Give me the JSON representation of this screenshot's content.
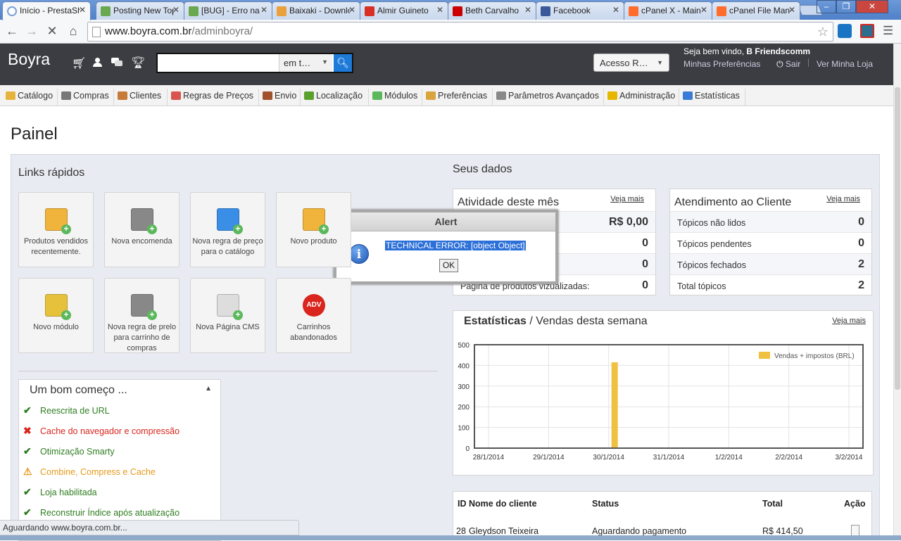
{
  "browser": {
    "tabs": [
      {
        "title": "Início - PrestaShop",
        "fav_color": "#ffffff",
        "active": true
      },
      {
        "title": "Posting New Topic",
        "fav_color": "#6aa84f",
        "active": false
      },
      {
        "title": "[BUG] - Erro na ...",
        "fav_color": "#6aa84f",
        "active": false
      },
      {
        "title": "Baixaki - Downloads",
        "fav_color": "#e9a23b",
        "active": false
      },
      {
        "title": "Almir Guineto",
        "fav_color": "#d93025",
        "active": false
      },
      {
        "title": "Beth Carvalho",
        "fav_color": "#cc0000",
        "active": false
      },
      {
        "title": "Facebook",
        "fav_color": "#3b5998",
        "active": false
      },
      {
        "title": "cPanel X - Main",
        "fav_color": "#ff6c2c",
        "active": false
      },
      {
        "title": "cPanel File Manager",
        "fav_color": "#ff6c2c",
        "active": false
      }
    ],
    "url_host": "www.boyra.com.br",
    "url_path": "/adminboyra/",
    "status_text": "Aguardando www.boyra.com.br..."
  },
  "header": {
    "brand": "Boyra",
    "search_scope": "em t…",
    "quick_access": "Acesso R…",
    "welcome_prefix": "Seja bem vindo,",
    "welcome_user": "B Friendscomm",
    "preferences_link": "Minhas Preferências",
    "logout_link": "Sair",
    "view_store_link": "Ver Minha Loja"
  },
  "menu": [
    {
      "label": "Catálogo",
      "color": "#e6b33c"
    },
    {
      "label": "Compras",
      "color": "#777777"
    },
    {
      "label": "Clientes",
      "color": "#c77b3a"
    },
    {
      "label": "Regras de Preços",
      "color": "#d9534f"
    },
    {
      "label": "Envio",
      "color": "#a0522d"
    },
    {
      "label": "Localização",
      "color": "#5aa02c"
    },
    {
      "label": "Módulos",
      "color": "#5cb85c"
    },
    {
      "label": "Preferências",
      "color": "#d9a43b"
    },
    {
      "label": "Parâmetros Avançados",
      "color": "#888888"
    },
    {
      "label": "Administração",
      "color": "#e5b700"
    },
    {
      "label": "Estatísticas",
      "color": "#3a7bd5"
    }
  ],
  "page": {
    "title": "Painel",
    "quick_links_title": "Links rápidos",
    "quick_links": [
      {
        "label": "Produtos vendidos recentemente.",
        "icon": "folder-arrow-icon",
        "color": "#f0b43c"
      },
      {
        "label": "Nova encomenda",
        "icon": "cart-add-icon",
        "color": "#888888"
      },
      {
        "label": "Nova regra de preço para o catálogo",
        "icon": "book-icon",
        "color": "#3a8ee6"
      },
      {
        "label": "Novo produto",
        "icon": "folder-add-icon",
        "color": "#f0b43c"
      },
      {
        "label": "Novo módulo",
        "icon": "puzzle-add-icon",
        "color": "#e6c23c"
      },
      {
        "label": "Nova regra de prelo para carrinho de compras",
        "icon": "cart-up-icon",
        "color": "#888888"
      },
      {
        "label": "Nova Página CMS",
        "icon": "page-add-icon",
        "color": "#dddddd"
      },
      {
        "label": "Carrinhos abandonados",
        "icon": "adv-badge-icon",
        "color": "#d9251d",
        "badge": "ADV"
      }
    ],
    "start_title": "Um bom começo ...",
    "start_items": [
      {
        "label": "Reescrita de URL",
        "status": "ok",
        "mark": "✔",
        "color": "#2e7d1f"
      },
      {
        "label": "Cache do navegador e compressão",
        "status": "error",
        "mark": "✖",
        "color": "#d9251d"
      },
      {
        "label": "Otimização Smarty",
        "status": "ok",
        "mark": "✔",
        "color": "#2e7d1f"
      },
      {
        "label": "Combine, Compress e Cache",
        "status": "warning",
        "mark": "⚠",
        "color": "#e69a1a"
      },
      {
        "label": "Loja habilitada",
        "status": "ok",
        "mark": "✔",
        "color": "#2e7d1f"
      },
      {
        "label": "Reconstruir Índice após atualização",
        "status": "ok",
        "mark": "✔",
        "color": "#2e7d1f"
      }
    ]
  },
  "your_data": {
    "title": "Seus dados",
    "activity": {
      "title": "Atividade deste mês",
      "more": "Veja mais",
      "rows": [
        {
          "label": "",
          "value": "R$ 0,00"
        },
        {
          "label": "",
          "value": "0"
        },
        {
          "label": "",
          "value": "0"
        },
        {
          "label": "Página de produtos vizualizadas:",
          "value": "0"
        }
      ]
    },
    "support": {
      "title": "Atendimento ao Cliente",
      "more": "Veja mais",
      "rows": [
        {
          "label": "Tópicos não lidos",
          "value": "0"
        },
        {
          "label": "Tópicos pendentes",
          "value": "0"
        },
        {
          "label": "Tópicos fechados",
          "value": "2"
        },
        {
          "label": "Total tópicos",
          "value": "2"
        }
      ]
    }
  },
  "stats": {
    "title_bold": "Estatísticas",
    "title_rest": "/ Vendas desta semana",
    "more": "Veja mais"
  },
  "chart_data": {
    "type": "bar",
    "categories": [
      "28/1/2014",
      "29/1/2014",
      "30/1/2014",
      "31/1/2014",
      "1/2/2014",
      "2/2/2014",
      "3/2/2014"
    ],
    "x_values": [
      "28/1/2014",
      "29/1/2014",
      "30/1/2014",
      "31/1/2014",
      "1/2/2014",
      "2/2/2014",
      "3/2/2014"
    ],
    "series": [
      {
        "name": "Vendas + impostos (BRL)",
        "color": "#f0c040",
        "points": [
          {
            "x": "30/1/2014",
            "y": 415
          }
        ]
      }
    ],
    "xlabel": "",
    "ylabel": "",
    "ylim": [
      0,
      500
    ],
    "yticks": [
      0,
      100,
      200,
      300,
      400,
      500
    ],
    "grid": true,
    "legend_position": "top-right"
  },
  "orders": {
    "headers": [
      "ID",
      "Nome do cliente",
      "Status",
      "Total",
      "Ação"
    ],
    "rows": [
      {
        "id": "28",
        "customer": "Gleydson Teixeira",
        "status": "Aguardando pagamento",
        "total": "R$ 414,50"
      }
    ]
  },
  "alert": {
    "title": "Alert",
    "message": "TECHNICAL ERROR: [object Object]",
    "ok_label": "OK"
  }
}
